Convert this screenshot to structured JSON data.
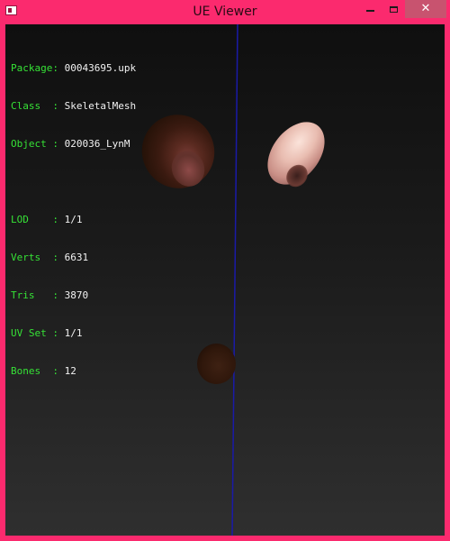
{
  "window": {
    "title": "UE Viewer",
    "accent_color": "#fb2a6e",
    "controls": {
      "minimize_icon": "minimize-icon",
      "maximize_icon": "maximize-icon",
      "close_icon": "close-icon",
      "close_symbol": "✕"
    }
  },
  "info": {
    "rows_group1": [
      {
        "label": "Package: ",
        "value": "00043695.upk"
      },
      {
        "label": "Class  : ",
        "value": "SkeletalMesh"
      },
      {
        "label": "Object : ",
        "value": "020036_LynM"
      }
    ],
    "rows_group2": [
      {
        "label": "LOD    : ",
        "value": "1/1"
      },
      {
        "label": "Verts  : ",
        "value": "6631"
      },
      {
        "label": "Tris   : ",
        "value": "3870"
      },
      {
        "label": "UV Set : ",
        "value": "1/1"
      },
      {
        "label": "Bones  : ",
        "value": "12"
      }
    ],
    "label_color": "#36e236",
    "value_color": "#f2f2f2"
  },
  "viewport": {
    "axis_color": "#1a1aa8",
    "background_top": "#0f0f0f",
    "background_bottom": "#2f2f2f"
  }
}
